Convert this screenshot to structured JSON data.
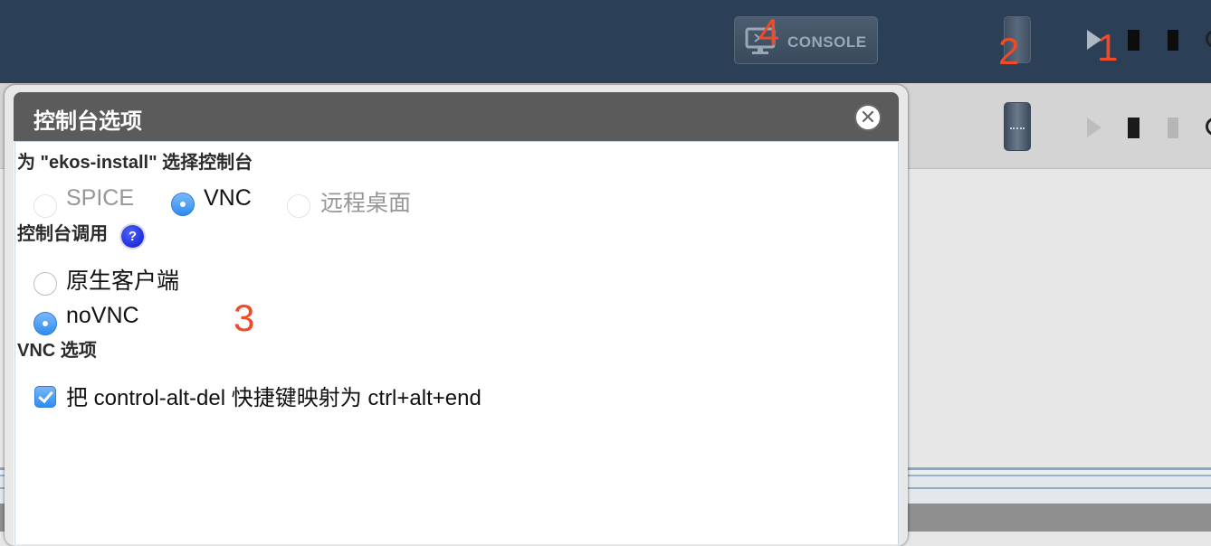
{
  "toolbar": {
    "console_label": "CONSOLE"
  },
  "annotations": {
    "a1": "1",
    "a2": "2",
    "a3": "3",
    "a4": "4"
  },
  "dialog": {
    "title": "控制台选项",
    "select_heading": "为 \"ekos-install\" 选择控制台",
    "protocol_options": [
      {
        "label": "SPICE",
        "selected": false,
        "disabled": true
      },
      {
        "label": "VNC",
        "selected": true,
        "disabled": false
      },
      {
        "label": "远程桌面",
        "selected": false,
        "disabled": true
      }
    ],
    "invocation_heading": "控制台调用",
    "help_symbol": "?",
    "invocation_options": [
      {
        "label": "原生客户端",
        "selected": false
      },
      {
        "label": "noVNC",
        "selected": true
      }
    ],
    "vnc_heading": "VNC 选项",
    "vnc_checkbox_label": "把 control-alt-del 快捷键映射为 ctrl+alt+end",
    "vnc_checkbox_checked": true,
    "close_symbol": "✕"
  },
  "colors": {
    "topbar": "#2b3f56",
    "annotation": "#f24a25",
    "accent": "#2f8cef",
    "dialog_title_bar": "#5b5b5b"
  },
  "icons": [
    "monitor-icon",
    "vm-icon",
    "play-icon",
    "stop-icon",
    "pause-icon",
    "help-icon",
    "close-icon",
    "checkmark-icon"
  ]
}
